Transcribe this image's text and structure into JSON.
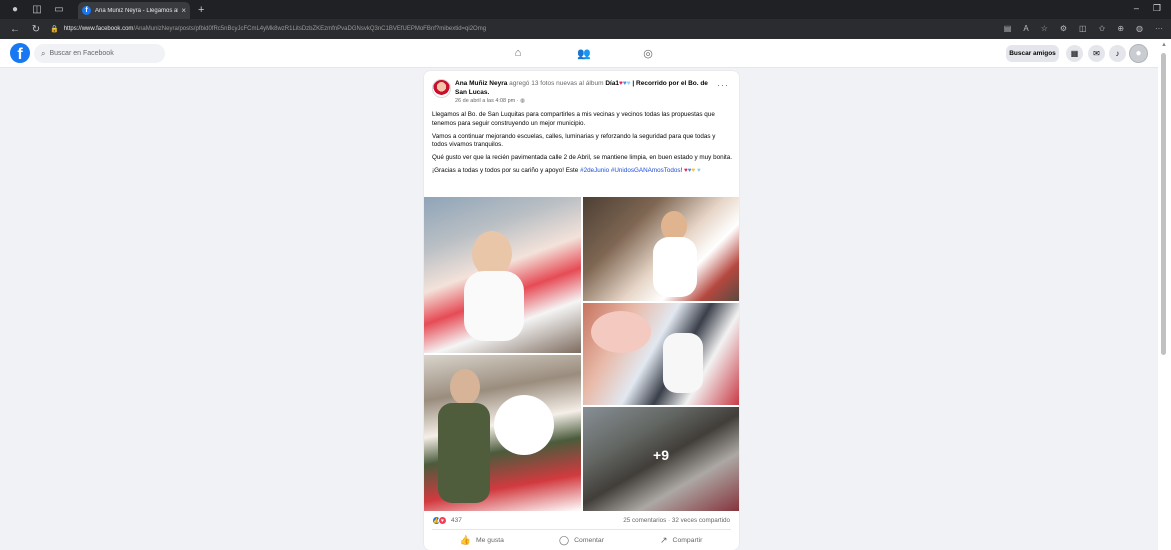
{
  "browser": {
    "tab_title": "Ana Muñiz Neyra - Llegamos al Bo...",
    "tab_close": "×",
    "new_tab": "+",
    "url_host": "https://www.facebook.com",
    "url_path": "/AnaMunizNeyra/posts/pfbid0fRc5nBcyJcFCmL4yMk8wzR1LitsDzbZKEzmfnPvaDGNsvkQ3nC1BVEfUEPMoFBnf?mibextid=qi2Omg"
  },
  "fb": {
    "search_placeholder": "Buscar en Facebook",
    "find_friends": "Buscar amigos",
    "logo": "f"
  },
  "post": {
    "author": "Ana Muñiz Neyra",
    "action": " agregó 13 fotos nuevas al álbum ",
    "album": "Día1",
    "album_rest": " | Recorrido por el Bo. de San Lucas.",
    "time": "26 de abril a las 4:08 pm · ",
    "more": "···",
    "paragraph1": "Llegamos al Bo. de San Luquitas para compartirles a mis vecinas y vecinos todas las propuestas que tenemos para seguir construyendo un mejor municipio.",
    "paragraph2": "Vamos a continuar mejorando escuelas, calles, luminarias y reforzando la seguridad para que todas y todos vivamos tranquilos.",
    "paragraph3": "Qué gusto ver que la recién pavimentada calle 2 de Abril, se mantiene limpia, en buen estado y muy bonita.",
    "paragraph4_start": "¡Gracias a todas y todos por su cariño y apoyo! Este ",
    "hashtag1": "#2deJunio",
    "paragraph4_mid": " ",
    "hashtag2": "#UnidosGANAmosTodos",
    "paragraph4_end": "! ",
    "extra_photos": "+9",
    "reaction_count": "437",
    "stats": "25 comentarios · 32 veces compartido",
    "like": "Me gusta",
    "comment": "Comentar",
    "share": "Compartir"
  },
  "icons": {
    "like_glyph": "👍",
    "comment_glyph": "◯",
    "share_glyph": "↗"
  },
  "colors": {
    "brand": "#1877f2",
    "background": "#f0f2f5"
  }
}
